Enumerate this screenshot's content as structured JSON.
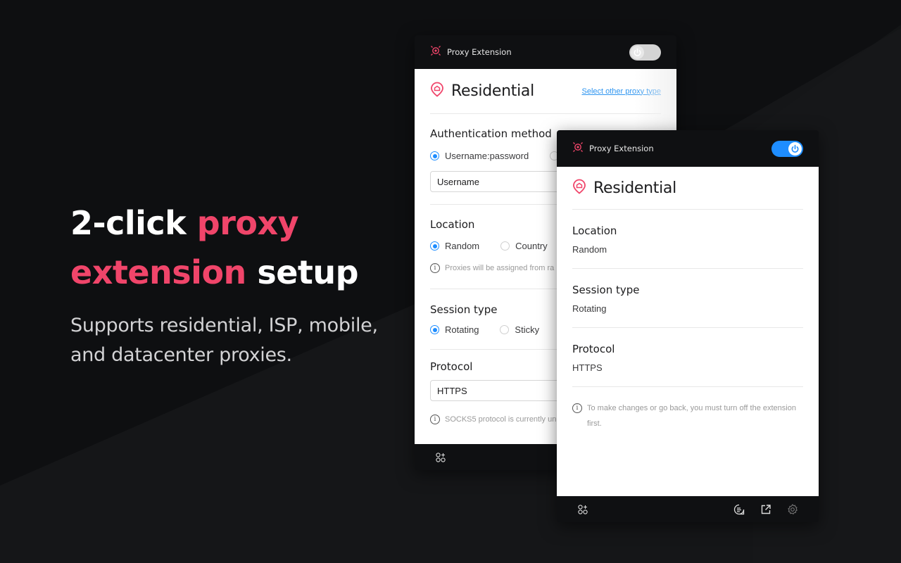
{
  "hero": {
    "title_part1": "2-click ",
    "title_accent1": "proxy",
    "title_accent2": "extension",
    "title_part2": " setup",
    "subtitle": "Supports residential, ISP, mobile, and datacenter proxies."
  },
  "colors": {
    "accent": "#f0456a",
    "toggle_on": "#1e8dff",
    "link": "#2e95f0"
  },
  "back_panel": {
    "header": {
      "brand": "Proxy Extension",
      "toggle_state": "off",
      "icon": "target-icon"
    },
    "title": "Residential",
    "title_icon": "home-pin-icon",
    "select_link": "Select other proxy type",
    "auth": {
      "title": "Authentication method",
      "options": [
        {
          "label": "Username:password",
          "checked": true
        },
        {
          "label": "",
          "checked": false
        }
      ],
      "username_placeholder": "Username"
    },
    "location": {
      "title": "Location",
      "options": [
        {
          "label": "Random",
          "checked": true
        },
        {
          "label": "Country",
          "checked": false
        }
      ],
      "hint": "Proxies will be assigned from ra"
    },
    "session": {
      "title": "Session type",
      "options": [
        {
          "label": "Rotating",
          "checked": true
        },
        {
          "label": "Sticky",
          "checked": false
        }
      ]
    },
    "protocol": {
      "title": "Protocol",
      "value": "HTTPS",
      "hint": "SOCKS5 protocol is currently un"
    },
    "footer": {
      "left_icon": "apps-add-icon"
    }
  },
  "front_panel": {
    "header": {
      "brand": "Proxy Extension",
      "toggle_state": "on",
      "icon": "target-icon"
    },
    "title": "Residential",
    "title_icon": "home-pin-icon",
    "sections": [
      {
        "title": "Location",
        "value": "Random"
      },
      {
        "title": "Session type",
        "value": "Rotating"
      },
      {
        "title": "Protocol",
        "value": "HTTPS"
      }
    ],
    "hint": "To make changes or go back, you must turn off the extension first.",
    "footer": {
      "left_icon": "apps-add-icon",
      "right_icons": [
        "chat-icon",
        "external-link-icon",
        "settings-icon"
      ]
    }
  }
}
